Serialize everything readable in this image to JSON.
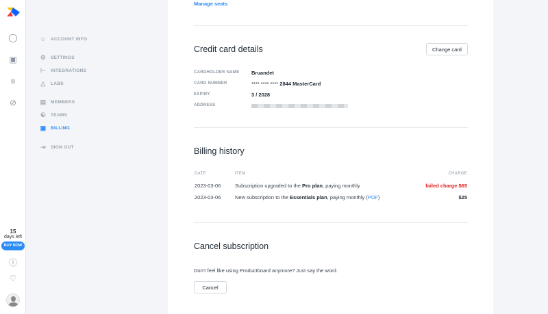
{
  "rail": {
    "trial_days": "15",
    "trial_text": "days left",
    "buy_label": "BUY NOW"
  },
  "nav": {
    "items": [
      {
        "label": "ACCOUNT INFO",
        "icon": "user-icon"
      },
      {
        "label": "SETTINGS",
        "icon": "gear-icon"
      },
      {
        "label": "INTEGRATIONS",
        "icon": "integrations-icon"
      },
      {
        "label": "LABS",
        "icon": "flask-icon"
      },
      {
        "label": "MEMBERS",
        "icon": "members-icon"
      },
      {
        "label": "TEAMS",
        "icon": "teams-icon"
      },
      {
        "label": "BILLING",
        "icon": "wallet-icon",
        "active": true
      },
      {
        "label": "SIGN OUT",
        "icon": "sign-out-icon"
      }
    ]
  },
  "main": {
    "manage_seats": "Manage seats",
    "card": {
      "title": "Credit card details",
      "change_label": "Change card",
      "cardholder_label": "CARDHOLDER NAME",
      "cardholder": "Bruandet",
      "number_label": "CARD NUMBER",
      "number_mask": "**** **** ****",
      "number": "2844 MasterCard",
      "expiry_label": "EXPIRY",
      "expiry": "3 / 2028",
      "address_label": "ADDRESS"
    },
    "history": {
      "title": "Billing history",
      "headers": {
        "date": "DATE",
        "item": "ITEM",
        "charge": "CHARGE"
      },
      "rows": [
        {
          "date": "2023-03-06",
          "pre": "Subscription upgraded to the ",
          "plan": "Pro plan",
          "post": ", paying monthly",
          "pdf": "",
          "charge": "failed charge $65",
          "failed": true
        },
        {
          "date": "2023-03-06",
          "pre": "New subscription to the ",
          "plan": "Essentials plan",
          "post": ", paying monthly (",
          "pdf": "PDF",
          "end": ")",
          "charge": "$25"
        }
      ]
    },
    "cancel": {
      "title": "Cancel subscription",
      "text": "Don't feel like using Productboard anymore? Just say the word.",
      "button": "Cancel"
    }
  },
  "colors": {
    "accent": "#2b8cf5",
    "error": "#e02020"
  }
}
